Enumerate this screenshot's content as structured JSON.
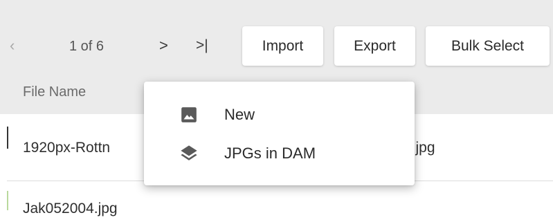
{
  "pager": {
    "text": "1 of 6",
    "prev_glyph": "‹",
    "next_glyph": ">",
    "last_glyph": ">|"
  },
  "toolbar": {
    "import_label": "Import",
    "export_label": "Export",
    "bulk_select_label": "Bulk Select"
  },
  "table": {
    "column_header": "File Name",
    "rows": [
      {
        "name_visible": "1920px-Rottn",
        "name_tail": "n.jpg"
      },
      {
        "name_visible": "Jak052004.jpg"
      }
    ]
  },
  "menu": {
    "items": [
      {
        "label": "New",
        "icon": "image-icon"
      },
      {
        "label": "JPGs in DAM",
        "icon": "layers-icon"
      }
    ]
  },
  "colors": {
    "header_bg": "#ebebeb",
    "row_accent": "#b9d99c"
  }
}
